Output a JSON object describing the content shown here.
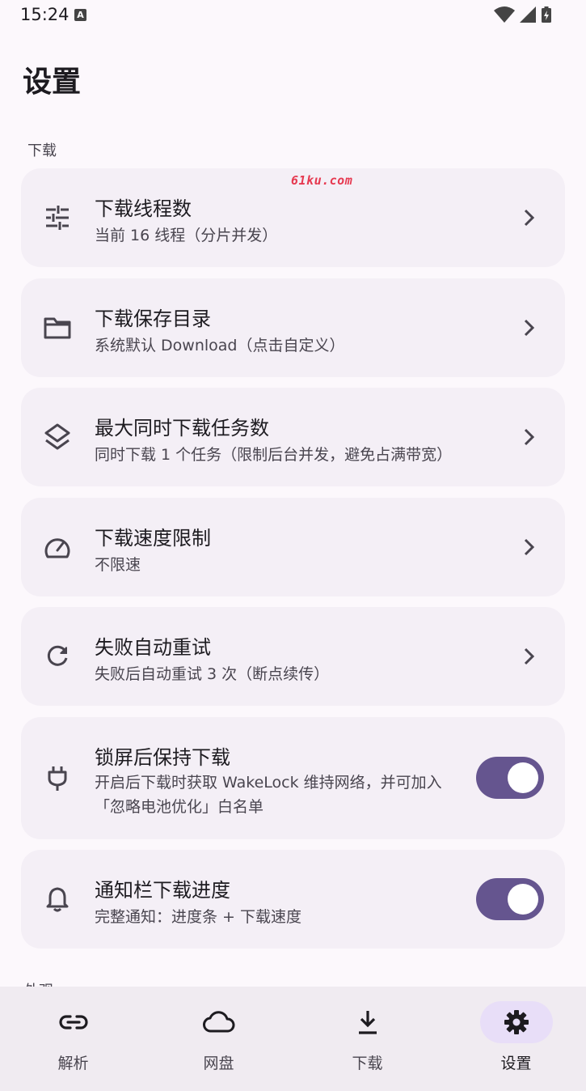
{
  "status_bar": {
    "time": "15:24",
    "notification_icon": "A"
  },
  "page": {
    "title": "设置",
    "section_download": "下载",
    "section_next_peek": "外观",
    "watermark": "61ku.com"
  },
  "settings": {
    "threads": {
      "title": "下载线程数",
      "subtitle": "当前 16 线程（分片并发）",
      "icon": "tune-icon"
    },
    "save_dir": {
      "title": "下载保存目录",
      "subtitle": "系统默认 Download（点击自定义）",
      "icon": "folder-icon"
    },
    "max_tasks": {
      "title": "最大同时下载任务数",
      "subtitle": "同时下载 1 个任务（限制后台并发，避免占满带宽）",
      "icon": "layers-icon"
    },
    "speed_limit": {
      "title": "下载速度限制",
      "subtitle": "不限速",
      "icon": "speed-icon"
    },
    "auto_retry": {
      "title": "失败自动重试",
      "subtitle": "失败后自动重试 3 次（断点续传）",
      "icon": "refresh-icon"
    },
    "keep_awake": {
      "title": "锁屏后保持下载",
      "subtitle_line1": "开启后下载时获取 WakeLock 维持网络，并可加入",
      "subtitle_line2": "「忽略电池优化」白名单",
      "icon": "plug-icon",
      "enabled": true
    },
    "notify_progress": {
      "title": "通知栏下载进度",
      "subtitle": "完整通知：进度条 + 下载速度",
      "icon": "bell-icon",
      "enabled": true
    }
  },
  "bottom_nav": {
    "items": [
      {
        "label": "解析",
        "icon": "link-icon",
        "active": false
      },
      {
        "label": "网盘",
        "icon": "cloud-icon",
        "active": false
      },
      {
        "label": "下载",
        "icon": "download-icon",
        "active": false
      },
      {
        "label": "设置",
        "icon": "gear-icon",
        "active": true
      }
    ]
  },
  "colors": {
    "accent": "#65558f",
    "active_indicator": "#e8def8",
    "card_bg": "#f4eff6",
    "background": "#fcf8fc"
  }
}
